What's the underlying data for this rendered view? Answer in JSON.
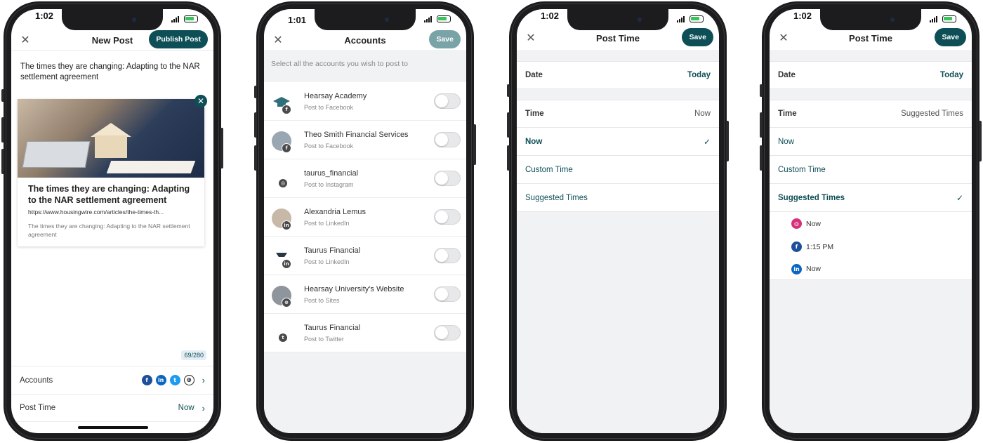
{
  "phones": {
    "p1": {
      "time": "1:02",
      "nav": {
        "close": "✕",
        "title": "New Post",
        "action": "Publish Post"
      },
      "post_text": "The times they are changing: Adapting to the NAR settlement agreement",
      "card": {
        "close": "✕",
        "title": "The times they are changing: Adapting to the NAR settlement agreement",
        "url": "https://www.housingwire.com/articles/the-times-th...",
        "description": "The times they are changing: Adapting to the NAR settlement agreement"
      },
      "counter": "69/280",
      "accounts_label": "Accounts",
      "account_icons": [
        "f",
        "in",
        "t",
        "⊕"
      ],
      "post_time_label": "Post Time",
      "post_time_value": "Now",
      "chevron": "›"
    },
    "p2": {
      "time": "1:01",
      "nav": {
        "close": "✕",
        "title": "Accounts",
        "action": "Save"
      },
      "hint": "Select all the accounts you wish to post to",
      "accounts": [
        {
          "name": "Hearsay Academy",
          "sub": "Post to Facebook",
          "badge": "f",
          "badge_color": "#4a4a4a"
        },
        {
          "name": "Theo Smith Financial Services",
          "sub": "Post to Facebook",
          "badge": "f",
          "badge_color": "#4a4a4a"
        },
        {
          "name": "taurus_financial",
          "sub": "Post to Instagram",
          "badge": "◎",
          "badge_color": "#4a4a4a"
        },
        {
          "name": "Alexandria Lemus",
          "sub": "Post to LinkedIn",
          "badge": "in",
          "badge_color": "#4a4a4a"
        },
        {
          "name": "Taurus Financial",
          "sub": "Post to LinkedIn",
          "badge": "in",
          "badge_color": "#4a4a4a"
        },
        {
          "name": "Hearsay University's Website",
          "sub": "Post to Sites",
          "badge": "⊕",
          "badge_color": "#4a4a4a"
        },
        {
          "name": "Taurus Financial",
          "sub": "Post to Twitter",
          "badge": "t",
          "badge_color": "#4a4a4a"
        }
      ]
    },
    "p3": {
      "time": "1:02",
      "nav": {
        "close": "✕",
        "title": "Post Time",
        "action": "Save"
      },
      "date_label": "Date",
      "date_value": "Today",
      "time_label": "Time",
      "time_value": "Now",
      "options": [
        "Now",
        "Custom Time",
        "Suggested Times"
      ],
      "check": "✓"
    },
    "p4": {
      "time": "1:02",
      "nav": {
        "close": "✕",
        "title": "Post Time",
        "action": "Save"
      },
      "date_label": "Date",
      "date_value": "Today",
      "time_label": "Time",
      "time_value": "Suggested Times",
      "options": [
        "Now",
        "Custom Time",
        "Suggested Times"
      ],
      "check": "✓",
      "suggested": [
        {
          "icon": "◎",
          "text": "Now"
        },
        {
          "icon": "f",
          "text": "1:15 PM"
        },
        {
          "icon": "in",
          "text": "Now"
        }
      ]
    }
  },
  "colors": {
    "accent": "#0e4e57",
    "facebook": "#1e4f9a",
    "linkedin": "#0b66c2",
    "twitter": "#1d9bf0",
    "instagram": "#d4317a"
  }
}
